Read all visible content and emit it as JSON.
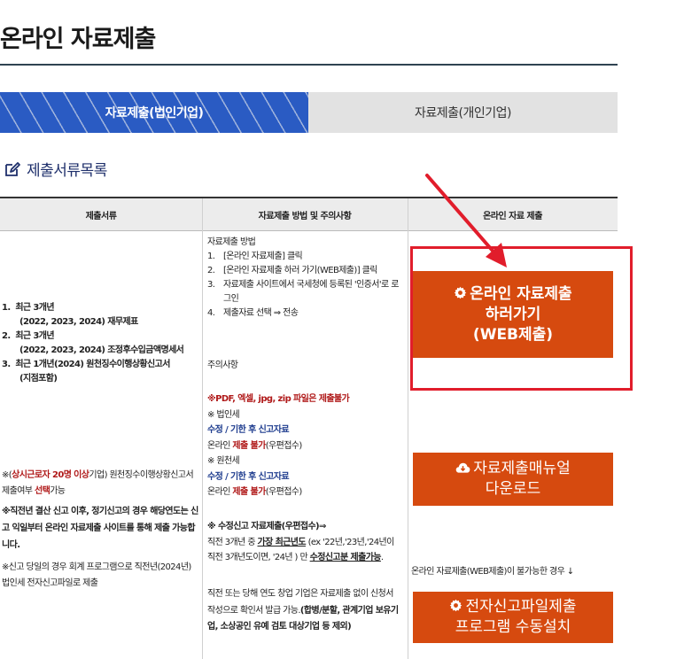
{
  "page": {
    "title": "온라인 자료제출"
  },
  "tabs": [
    {
      "label": "자료제출(법인기업)",
      "active": true
    },
    {
      "label": "자료제출(개인기업)",
      "active": false
    }
  ],
  "section": {
    "title": "제출서류목록"
  },
  "table": {
    "headers": [
      "제출서류",
      "자료제출 방법 및 주의사항",
      "온라인 자료 제출"
    ]
  },
  "docs": {
    "items": [
      {
        "num": "1.",
        "title": "최근 3개년",
        "sub": "(2022, 2023, 2024) 재무제표"
      },
      {
        "num": "2.",
        "title": "최근 3개년",
        "sub": "(2022, 2023, 2024) 조정후수입금액명세서"
      },
      {
        "num": "3.",
        "title": "최근 1개년(2024) 원천징수이행상황신고서",
        "sub": "(지점포함)"
      }
    ],
    "note1_prefix": "※(",
    "note1_red": "상시근로자 20명 이상",
    "note1_mid": "기업) 원천징수이행상황신고서 제출여부 ",
    "note1_red2": "선택",
    "note1_suffix": "가능",
    "note2": "※직전년 결산 신고 이후, 정기신고의 경우 해당연도는 신고 익일부터 온라인 자료제출 사이트를 통해 제출 가능합니다.",
    "note3": "※신고 당일의 경우 회계 프로그램으로 직전년(2024년) 법인세 전자신고파일로 제출"
  },
  "method": {
    "heading": "자료제출 방법",
    "steps": [
      {
        "num": "1.",
        "text": "[온라인 자료제출] 클릭"
      },
      {
        "num": "2.",
        "text": "[온라인 자료제출 하러 가기(WEB제출)] 클릭"
      },
      {
        "num": "3.",
        "text": "자료제출 사이트에서 국세청에 등록된 '인증서'로 로그인"
      },
      {
        "num": "4.",
        "text": "제출자료 선택 ⇒ 전송"
      }
    ],
    "caution_heading": "주의사항",
    "pdf_warning": "※PDF, 엑셀, jpg, zip 파일은 제출불가",
    "corp_tax": "※ 법인세",
    "corp_amend": "수정 / 기한 후 신고자료",
    "corp_online_prefix": "온라인 ",
    "corp_online_red": "제출 불가",
    "corp_online_suffix": "(우편접수)",
    "wh_tax": "※ 원천세",
    "wh_amend": "수정 / 기한 후 신고자료",
    "wh_online_prefix": "온라인 ",
    "wh_online_red": "제출 불가",
    "wh_online_suffix": "(우편접수)",
    "amend_heading": "※ 수정신고 자료제출(우편접수)⇒",
    "amend_a": "직전 3개년 중 ",
    "amend_b": "가장 최근년도",
    "amend_c": " (ex '22년,'23년,'24년이 직전 3개년도이면, '24년 )",
    "amend_d": " 만 ",
    "amend_e": "수정신고분 제출가능",
    "amend_f": ".",
    "new_corp": "직전 또는 당해 연도 창업 기업은 자료제출 없이 신청서 작성으로 확인서 발급 가능.",
    "new_corp_bold": "(합병/분할, 관계기업 보유기업, 소상공인 유예 검토 대상기업 등 제외)"
  },
  "online": {
    "web_button_line1": "온라인 자료제출",
    "web_button_line2": "하러가기",
    "web_button_line3": "(WEB제출)",
    "manual_button_line1": "자료제출매뉴얼",
    "manual_button_line2": "다운로드",
    "fallback_note": "온라인 자료제출(WEB제출)이 불가능한 경우 ↓",
    "install_button_line1": "전자신고파일제출",
    "install_button_line2": "프로그램 수동설치"
  },
  "colors": {
    "accent_orange": "#d64a0f",
    "highlight_red": "#e11d2b",
    "tab_blue": "#2a5bc3",
    "title_navy": "#1e2f6b"
  },
  "icons": [
    "edit-icon",
    "gear-icon",
    "cloud-download-icon",
    "arrow-icon"
  ]
}
